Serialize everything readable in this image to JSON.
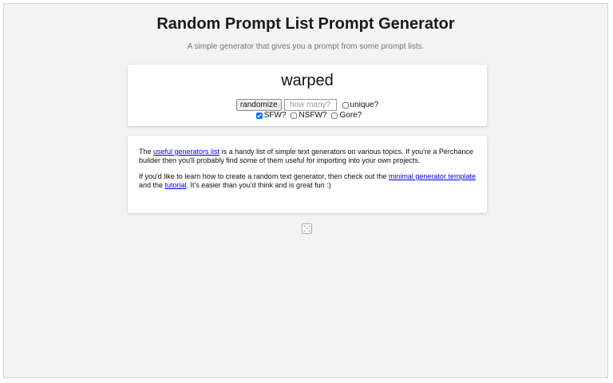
{
  "header": {
    "title": "Random Prompt List Prompt Generator",
    "subtitle": "A simple generator that gives you a prompt from some prompt lists."
  },
  "output": {
    "text": "warped"
  },
  "controls": {
    "randomize_label": "randomize",
    "count_placeholder": "how many?",
    "unique_label": "unique?",
    "sfw_label": "SFW?",
    "nsfw_label": "NSFW?",
    "gore_label": "Gore?"
  },
  "info": {
    "p1_before": "The ",
    "p1_link": "useful generators list",
    "p1_after": " is a handy list of simple text generators on various topics. If you're a Perchance builder then you'll probably find some of them useful for importing into your own projects.",
    "p2_before": "If you'd like to learn how to create a random text generator, then check out the ",
    "p2_link1": "minimal generator template",
    "p2_mid": " and the ",
    "p2_link2": "tutorial",
    "p2_after": ". It's easier than you'd think and is great fun :)"
  },
  "icons": {
    "footer": "dice-icon"
  }
}
